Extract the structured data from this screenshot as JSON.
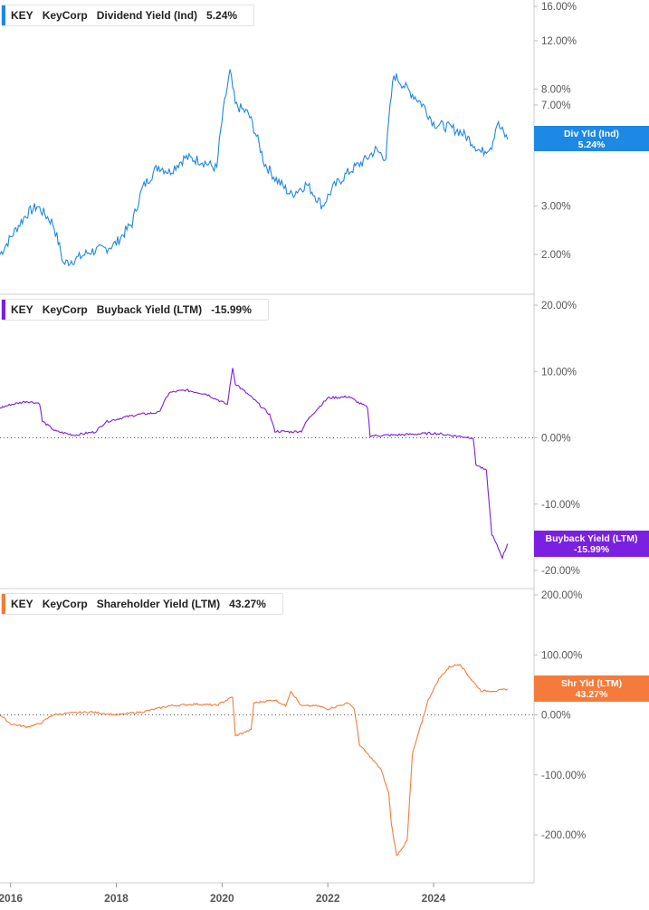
{
  "chart_data": [
    {
      "type": "line",
      "ticker": "KEY",
      "company": "KeyCorp",
      "metric": "Dividend Yield (Ind)",
      "current": "5.24%",
      "tag_label": "Div Yld (Ind)",
      "tag_value": "5.24%",
      "color": "#1e88e5",
      "scale": "log",
      "yticks": [
        "16.00%",
        "12.00%",
        "8.00%",
        "7.00%",
        "5.00%",
        "3.00%",
        "2.00%"
      ],
      "ytick_values": [
        16,
        12,
        8,
        7,
        5,
        3,
        2
      ],
      "x": [
        2015.8,
        2016.0,
        2016.3,
        2016.5,
        2016.8,
        2017.0,
        2017.3,
        2017.5,
        2017.8,
        2018.0,
        2018.3,
        2018.5,
        2018.8,
        2019.0,
        2019.3,
        2019.6,
        2019.9,
        2020.15,
        2020.25,
        2020.5,
        2020.8,
        2021.0,
        2021.3,
        2021.6,
        2021.9,
        2022.1,
        2022.4,
        2022.7,
        2022.9,
        2023.1,
        2023.25,
        2023.5,
        2023.8,
        2024.0,
        2024.3,
        2024.5,
        2024.7,
        2024.9,
        2025.1,
        2025.2,
        2025.4
      ],
      "y": [
        2.0,
        2.3,
        2.8,
        3.0,
        2.6,
        1.85,
        1.95,
        2.05,
        2.1,
        2.2,
        2.6,
        3.5,
        4.2,
        4.0,
        4.5,
        4.4,
        4.1,
        9.2,
        7.0,
        6.5,
        4.3,
        3.8,
        3.3,
        3.6,
        3.0,
        3.5,
        4.0,
        4.4,
        4.8,
        4.5,
        9.0,
        8.0,
        7.0,
        6.0,
        5.8,
        5.6,
        5.2,
        4.7,
        5.0,
        6.0,
        5.24
      ]
    },
    {
      "type": "line",
      "ticker": "KEY",
      "company": "KeyCorp",
      "metric": "Buyback Yield (LTM)",
      "current": "-15.99%",
      "tag_label": "Buyback Yield (LTM)",
      "tag_value": "-15.99%",
      "color": "#7b1fe0",
      "scale": "linear",
      "yticks": [
        "20.00%",
        "10.00%",
        "0.00%",
        "-10.00%",
        "-20.00%"
      ],
      "ytick_values": [
        20,
        10,
        0,
        -10,
        -20
      ],
      "zero_line": true,
      "x": [
        2015.8,
        2016.0,
        2016.3,
        2016.55,
        2016.6,
        2016.85,
        2017.2,
        2017.6,
        2017.8,
        2018.1,
        2018.4,
        2018.8,
        2019.0,
        2019.3,
        2019.7,
        2019.9,
        2020.1,
        2020.2,
        2020.25,
        2020.35,
        2020.6,
        2020.9,
        2021.0,
        2021.3,
        2021.5,
        2021.6,
        2021.7,
        2022.0,
        2022.4,
        2022.6,
        2022.75,
        2022.8,
        2023.2,
        2023.5,
        2024.0,
        2024.5,
        2024.75,
        2024.8,
        2025.0,
        2025.1,
        2025.3,
        2025.4
      ],
      "y": [
        4.5,
        5.0,
        5.5,
        5.2,
        2.5,
        1.0,
        0.4,
        0.9,
        2.4,
        3.0,
        3.5,
        3.8,
        6.8,
        7.2,
        6.6,
        5.8,
        5.0,
        10.6,
        8.2,
        7.5,
        5.8,
        3.5,
        1.0,
        0.9,
        1.0,
        2.5,
        3.5,
        6.0,
        6.2,
        5.2,
        4.6,
        0.3,
        0.4,
        0.5,
        0.7,
        0.2,
        0.0,
        -4.0,
        -5.0,
        -14.5,
        -18.0,
        -15.99
      ]
    },
    {
      "type": "line",
      "ticker": "KEY",
      "company": "KeyCorp",
      "metric": "Shareholder Yield (LTM)",
      "current": "43.27%",
      "tag_label": "Shr Yld (LTM)",
      "tag_value": "43.27%",
      "color": "#f47b3b",
      "scale": "linear",
      "yticks": [
        "200.00%",
        "100.00%",
        "0.00%",
        "-100.00%",
        "-200.00%"
      ],
      "ytick_values": [
        200,
        100,
        0,
        -100,
        -200
      ],
      "zero_line": true,
      "x": [
        2015.8,
        2016.0,
        2016.3,
        2016.55,
        2016.8,
        2017.0,
        2017.5,
        2018.0,
        2018.5,
        2019.0,
        2019.5,
        2019.9,
        2020.2,
        2020.25,
        2020.55,
        2020.6,
        2021.0,
        2021.2,
        2021.3,
        2021.5,
        2021.8,
        2022.0,
        2022.4,
        2022.5,
        2022.6,
        2022.8,
        2023.0,
        2023.15,
        2023.2,
        2023.3,
        2023.5,
        2023.6,
        2023.9,
        2024.1,
        2024.3,
        2024.5,
        2024.7,
        2024.9,
        2025.2,
        2025.4
      ],
      "y": [
        0,
        -15,
        -20,
        -15,
        0,
        2,
        5,
        0,
        5,
        15,
        18,
        16,
        30,
        -35,
        -25,
        20,
        25,
        15,
        40,
        15,
        15,
        10,
        20,
        10,
        -50,
        -70,
        -90,
        -130,
        -180,
        -235,
        -210,
        -65,
        25,
        60,
        80,
        85,
        60,
        40,
        40,
        43.27
      ]
    }
  ],
  "x_axis": {
    "ticks": [
      "2016",
      "2018",
      "2020",
      "2022",
      "2024"
    ],
    "tick_values": [
      2016,
      2018,
      2020,
      2022,
      2024
    ]
  }
}
